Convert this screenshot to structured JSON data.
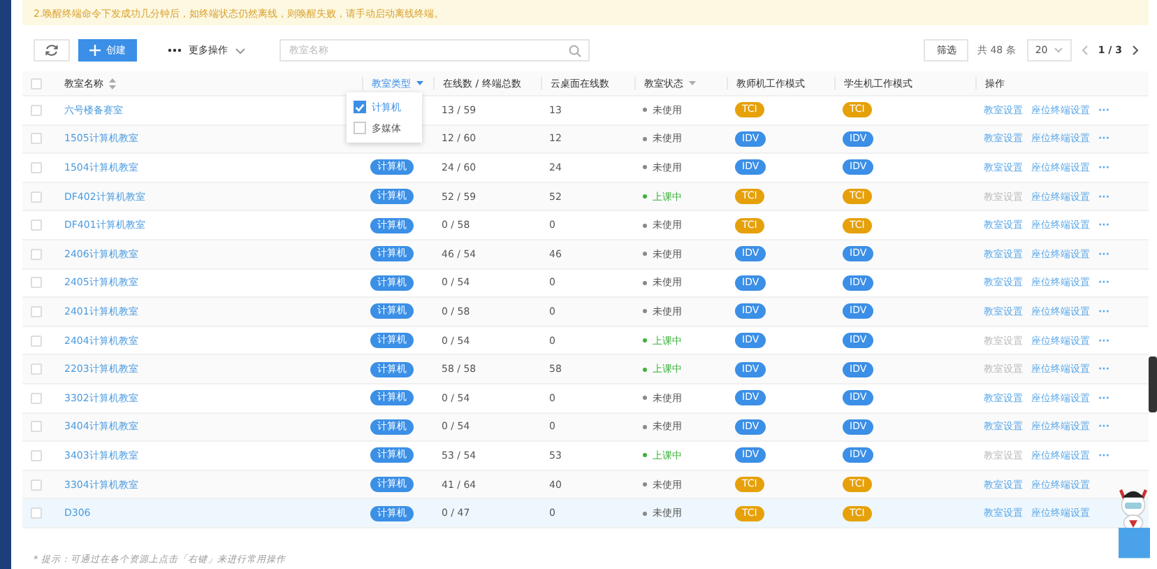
{
  "notice": "2.唤醒终端命令下发成功几分钟后，如终端状态仍然离线，则唤醒失败，请手动启动离线终端。",
  "toolbar": {
    "create": "创建",
    "more": "更多操作",
    "search_placeholder": "教室名称",
    "filter": "筛选",
    "total": "共 48 条",
    "page_size": "20",
    "page": "1 / 3"
  },
  "columns": [
    {
      "label": "教室名称",
      "kind": "sort",
      "active": false
    },
    {
      "label": "教室类型",
      "kind": "filter",
      "active": true
    },
    {
      "label": "在线数 / 终端总数",
      "kind": "plain",
      "active": false
    },
    {
      "label": "云桌面在线数",
      "kind": "plain",
      "active": false
    },
    {
      "label": "教室状态",
      "kind": "filter",
      "active": false
    },
    {
      "label": "教师机工作模式",
      "kind": "plain",
      "active": false
    },
    {
      "label": "学生机工作模式",
      "kind": "plain",
      "active": false
    },
    {
      "label": "操作",
      "kind": "plain",
      "active": false
    }
  ],
  "select_all": false,
  "type_filter": [
    {
      "label": "计算机",
      "checked": true
    },
    {
      "label": "多媒体",
      "checked": false
    }
  ],
  "rows": [
    {
      "name": "六号楼备赛室",
      "online": "13 / 59",
      "cloud": "13",
      "status": "未使用",
      "in_class": false,
      "teacher_mode": "TCI",
      "student_mode": "TCI",
      "settings": "教室设置",
      "seat": "座位终端设置",
      "more": "···",
      "hover": false
    },
    {
      "name": "1505计算机教室",
      "online": "12 / 60",
      "cloud": "12",
      "status": "未使用",
      "in_class": false,
      "teacher_mode": "IDV",
      "student_mode": "IDV",
      "settings": "教室设置",
      "seat": "座位终端设置",
      "more": "···",
      "hover": false
    },
    {
      "name": "1504计算机教室",
      "type": "计算机",
      "online": "24 / 60",
      "cloud": "24",
      "status": "未使用",
      "in_class": false,
      "teacher_mode": "IDV",
      "student_mode": "IDV",
      "settings": "教室设置",
      "seat": "座位终端设置",
      "more": "···",
      "hover": false
    },
    {
      "name": "DF402计算机教室",
      "type": "计算机",
      "online": "52 / 59",
      "cloud": "52",
      "status": "上课中",
      "in_class": true,
      "teacher_mode": "TCI",
      "student_mode": "TCI",
      "settings": "教室设置",
      "seat": "座位终端设置",
      "more": "···",
      "hover": false
    },
    {
      "name": "DF401计算机教室",
      "type": "计算机",
      "online": "0 / 58",
      "cloud": "0",
      "status": "未使用",
      "in_class": false,
      "teacher_mode": "TCI",
      "student_mode": "TCI",
      "settings": "教室设置",
      "seat": "座位终端设置",
      "more": "···",
      "hover": false
    },
    {
      "name": "2406计算机教室",
      "type": "计算机",
      "online": "46 / 54",
      "cloud": "46",
      "status": "未使用",
      "in_class": false,
      "teacher_mode": "IDV",
      "student_mode": "IDV",
      "settings": "教室设置",
      "seat": "座位终端设置",
      "more": "···",
      "hover": false
    },
    {
      "name": "2405计算机教室",
      "type": "计算机",
      "online": "0 / 54",
      "cloud": "0",
      "status": "未使用",
      "in_class": false,
      "teacher_mode": "IDV",
      "student_mode": "IDV",
      "settings": "教室设置",
      "seat": "座位终端设置",
      "more": "···",
      "hover": false
    },
    {
      "name": "2401计算机教室",
      "type": "计算机",
      "online": "0 / 58",
      "cloud": "0",
      "status": "未使用",
      "in_class": false,
      "teacher_mode": "IDV",
      "student_mode": "IDV",
      "settings": "教室设置",
      "seat": "座位终端设置",
      "more": "···",
      "hover": false
    },
    {
      "name": "2404计算机教室",
      "type": "计算机",
      "online": "0 / 54",
      "cloud": "0",
      "status": "上课中",
      "in_class": true,
      "teacher_mode": "IDV",
      "student_mode": "IDV",
      "settings": "教室设置",
      "seat": "座位终端设置",
      "more": "···",
      "hover": false
    },
    {
      "name": "2203计算机教室",
      "type": "计算机",
      "online": "58 / 58",
      "cloud": "58",
      "status": "上课中",
      "in_class": true,
      "teacher_mode": "IDV",
      "student_mode": "IDV",
      "settings": "教室设置",
      "seat": "座位终端设置",
      "more": "···",
      "hover": false
    },
    {
      "name": "3302计算机教室",
      "type": "计算机",
      "online": "0 / 54",
      "cloud": "0",
      "status": "未使用",
      "in_class": false,
      "teacher_mode": "IDV",
      "student_mode": "IDV",
      "settings": "教室设置",
      "seat": "座位终端设置",
      "more": "···",
      "hover": false
    },
    {
      "name": "3404计算机教室",
      "type": "计算机",
      "online": "0 / 54",
      "cloud": "0",
      "status": "未使用",
      "in_class": false,
      "teacher_mode": "IDV",
      "student_mode": "IDV",
      "settings": "教室设置",
      "seat": "座位终端设置",
      "more": "···",
      "hover": false
    },
    {
      "name": "3403计算机教室",
      "type": "计算机",
      "online": "53 / 54",
      "cloud": "53",
      "status": "上课中",
      "in_class": true,
      "teacher_mode": "IDV",
      "student_mode": "IDV",
      "settings": "教室设置",
      "seat": "座位终端设置",
      "more": "···",
      "hover": false
    },
    {
      "name": "3304计算机教室",
      "type": "计算机",
      "online": "41 / 64",
      "cloud": "40",
      "status": "未使用",
      "in_class": false,
      "teacher_mode": "TCI",
      "student_mode": "TCI",
      "settings": "教室设置",
      "seat": "座位终端设置",
      "hover": false
    },
    {
      "name": "D306",
      "type": "计算机",
      "online": "0 / 47",
      "cloud": "0",
      "status": "未使用",
      "in_class": false,
      "teacher_mode": "TCI",
      "student_mode": "TCI",
      "settings": "教室设置",
      "seat": "座位终端设置",
      "hover": true
    }
  ],
  "hint": "* 提示：可通过在各个资源上点击「右键」来进行常用操作"
}
